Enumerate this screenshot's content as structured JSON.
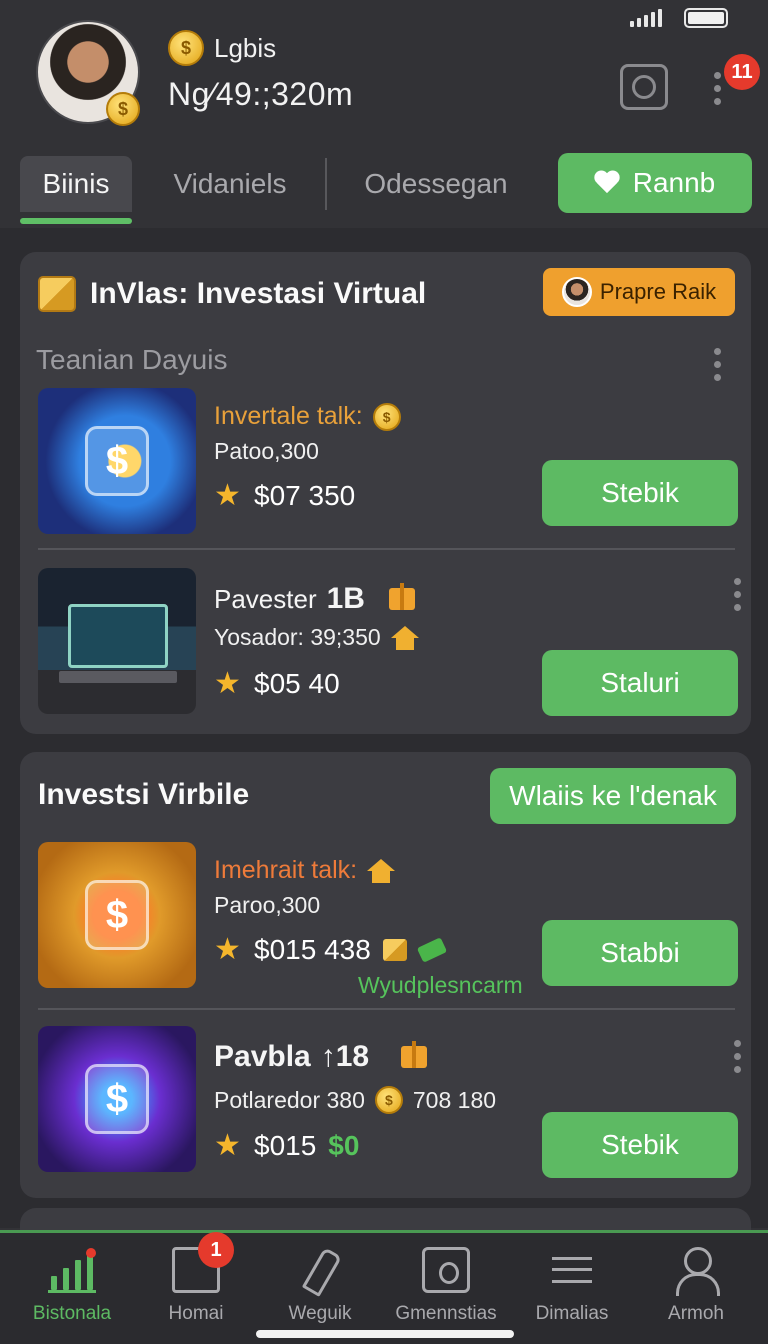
{
  "header": {
    "user_name": "Lgbis",
    "balance": "Ng⁄49:;320m",
    "notification_count": "11"
  },
  "tabs": {
    "items": [
      "Biinis",
      "Vidaniels",
      "Odessegan"
    ],
    "action_label": "Rannb"
  },
  "card1": {
    "title": "InVlas: Investasi Virtual",
    "badge_label": "Prapre Raik",
    "section_label": "Teanian Dayuis",
    "items": [
      {
        "title": "Invertale talk:",
        "subtitle": "Patoo,300",
        "price": "$07 350",
        "button": "Stebik"
      },
      {
        "title": "Pavester",
        "title_strong": "1B",
        "subtitle": "Yosador: 39;350",
        "price": "$05 40",
        "button": "Staluri"
      }
    ]
  },
  "card2": {
    "title": "Investsi Virbile",
    "action_label": "Wlaiis ke l'denak",
    "items": [
      {
        "title": "Imehrait talk:",
        "subtitle": "Paroo,300",
        "price": "$015 438",
        "note": "Wyudplesncarm",
        "button": "Stabbi"
      },
      {
        "title": "Pavbla",
        "title_strong": "↑18",
        "subtitle": "Potlaredor 380",
        "subtitle_extra": "708 180",
        "price": "$015",
        "price_extra": "$0",
        "button": "Stebik"
      }
    ]
  },
  "bottom_nav": {
    "items": [
      "Bistonala",
      "Homai",
      "Weguik",
      "Gmennstias",
      "Dimalias",
      "Armoh"
    ],
    "badge": "1"
  },
  "icons": {
    "coin": "$",
    "star": "★"
  },
  "colors": {
    "accent_green": "#5dba63",
    "accent_orange": "#efa02e",
    "badge_red": "#e53a2c",
    "background": "#323236"
  }
}
